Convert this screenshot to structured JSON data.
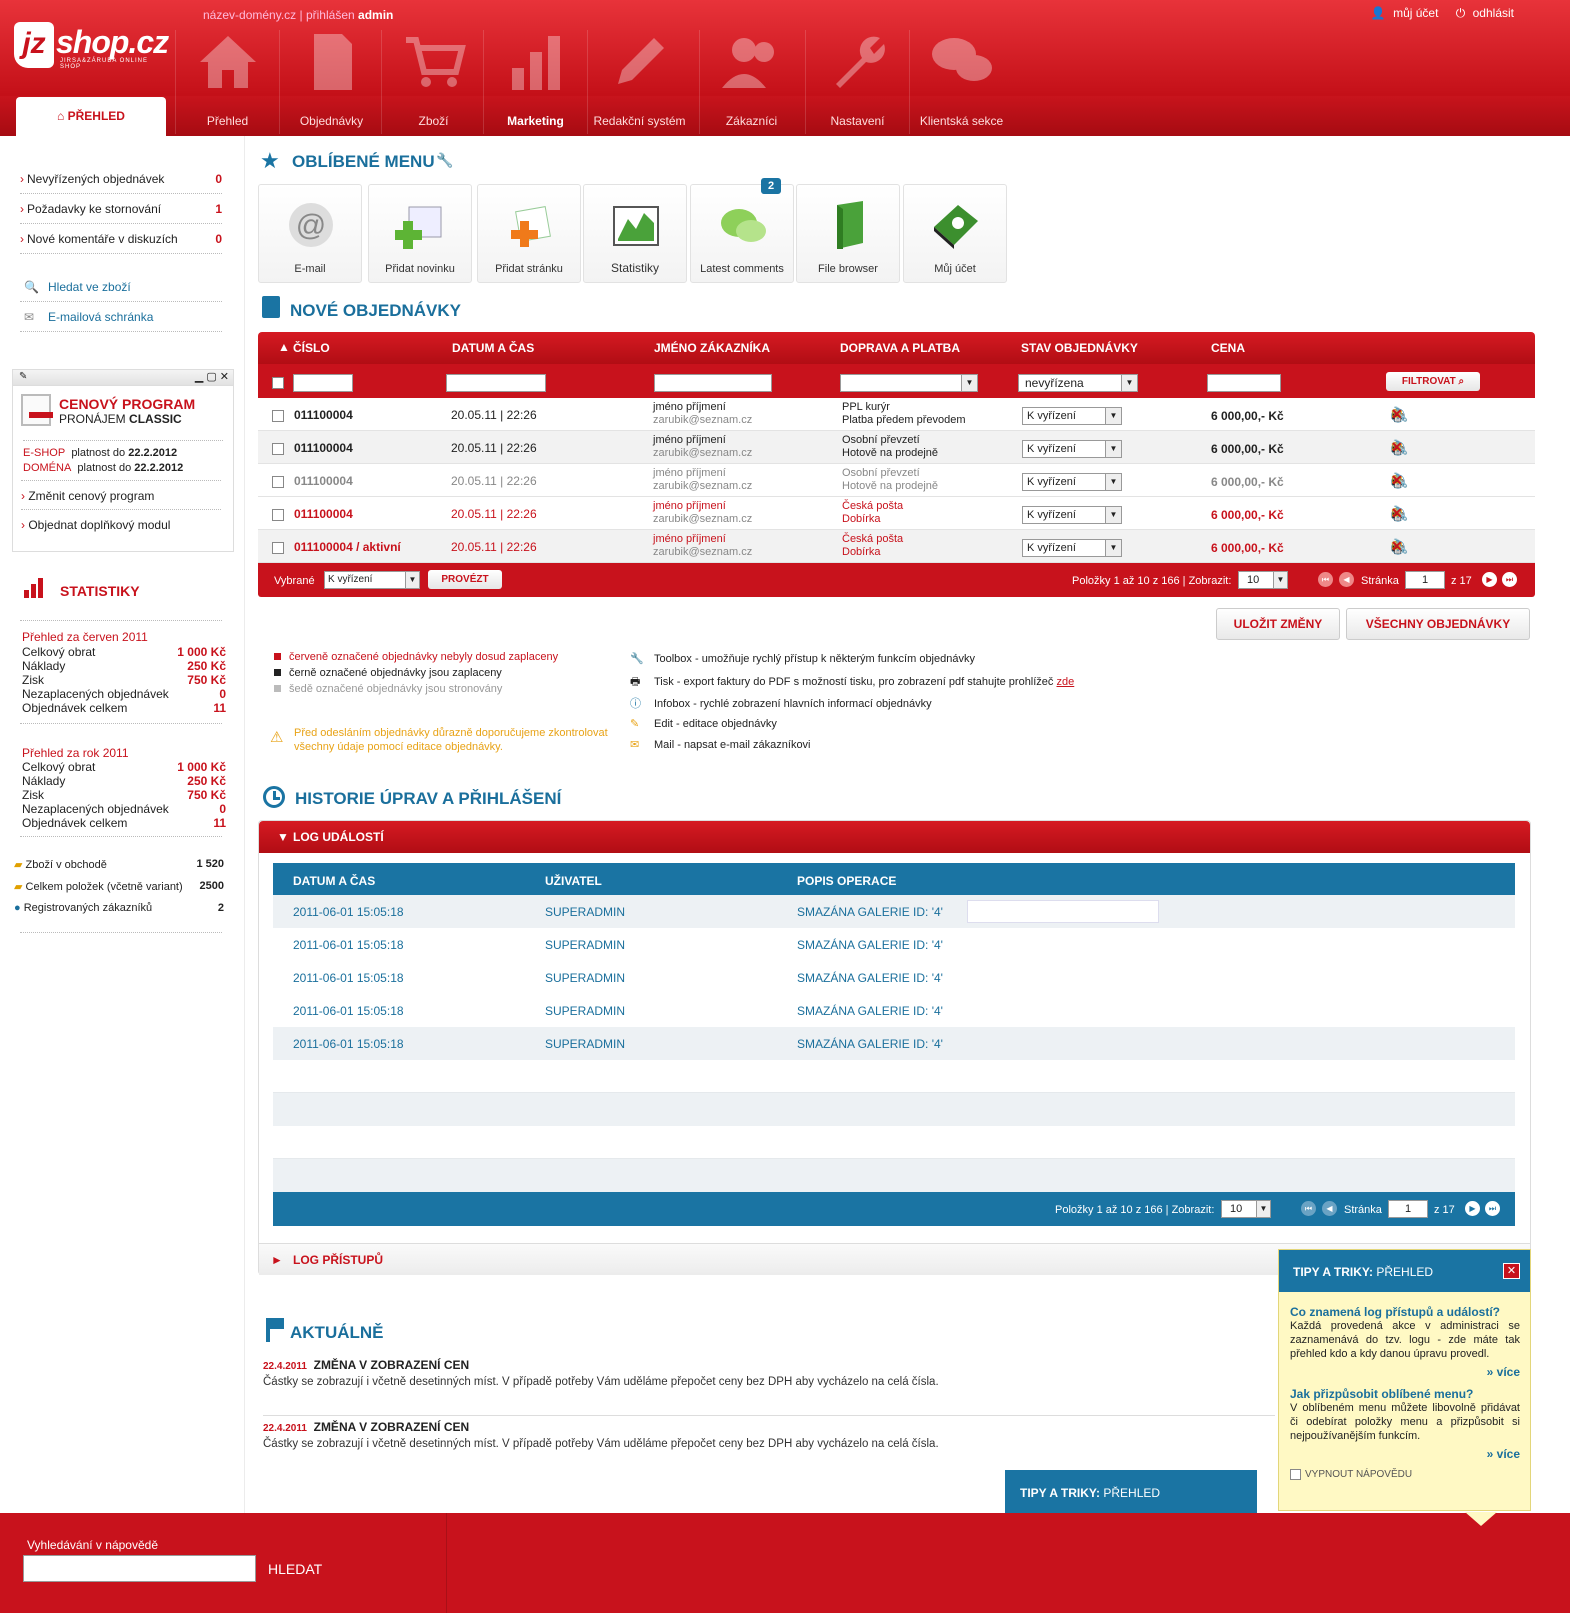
{
  "header": {
    "logo_main": "jz",
    "logo_shop": "shop.cz",
    "logo_sub": "JIRSA&ZÁRUBA ONLINE SHOP",
    "domain": "název-domény.cz",
    "separator": "|",
    "logged_in_label": "přihlášen",
    "user": "admin",
    "my_account": "můj účet",
    "logout": "odhlásit",
    "active_tab": "PŘEHLED",
    "nav": [
      "Přehled",
      "Objednávky",
      "Zboží",
      "Marketing",
      "Redakční systém",
      "Zákazníci",
      "Nastavení",
      "Klientská sekce"
    ]
  },
  "sidebar": {
    "counters": [
      {
        "label": "Nevyřízených objednávek",
        "count": "0"
      },
      {
        "label": "Požadavky ke stornování",
        "count": "1"
      },
      {
        "label": "Nové komentáře v diskuzích",
        "count": "0"
      }
    ],
    "links": [
      "Hledat ve zboží",
      "E-mailová schránka"
    ],
    "price_program": {
      "title": "CENOVÝ PROGRAM",
      "sub_prefix": "PRONÁJEM",
      "sub_bold": "CLASSIC",
      "eshop_label": "E-SHOP",
      "eshop_text": "platnost do",
      "eshop_date": "22.2.2012",
      "domain_label": "DOMÉNA",
      "domain_text": "platnost do",
      "domain_date": "22.2.2012",
      "change": "Změnit cenový program",
      "order_module": "Objednat doplňkový modul"
    },
    "stats": {
      "title": "STATISTIKY",
      "month_title": "Přehled za červen 2011",
      "year_title": "Přehled za rok 2011",
      "month": [
        {
          "l": "Celkový obrat",
          "v": "1 000 Kč"
        },
        {
          "l": "Náklady",
          "v": "250 Kč"
        },
        {
          "l": "Zisk",
          "v": "750 Kč"
        },
        {
          "l": "Nezaplacených objednávek",
          "v": "0"
        },
        {
          "l": "Objednávek celkem",
          "v": "11"
        }
      ],
      "year": [
        {
          "l": "Celkový obrat",
          "v": "1 000 Kč"
        },
        {
          "l": "Náklady",
          "v": "250 Kč"
        },
        {
          "l": "Zisk",
          "v": "750 Kč"
        },
        {
          "l": "Nezaplacených objednávek",
          "v": "0"
        },
        {
          "l": "Objednávek celkem",
          "v": "11"
        }
      ],
      "totals": [
        {
          "l": "Zboží v obchodě",
          "v": "1 520"
        },
        {
          "l": "Celkem položek (včetně variant)",
          "v": "2500"
        },
        {
          "l": "Registrovaných zákazníků",
          "v": "2"
        }
      ]
    }
  },
  "favorites": {
    "title": "OBLÍBENÉ MENU",
    "items": [
      "E-mail",
      "Přidat novinku",
      "Přidat stránku",
      "Statistiky",
      "Latest comments",
      "File browser",
      "Můj účet"
    ],
    "comments_badge": "2"
  },
  "orders": {
    "title": "NOVÉ OBJEDNÁVKY",
    "columns": [
      "ČÍSLO",
      "DATUM A ČAS",
      "JMÉNO ZÁKAZNÍKA",
      "DOPRAVA A PLATBA",
      "STAV OBJEDNÁVKY",
      "CENA"
    ],
    "filter_state": "nevyřízena",
    "filter_button": "FILTROVAT",
    "rows": [
      {
        "num": "011100004",
        "date": "20.05.11 | 22:26",
        "name": "jméno příjmení",
        "email": "zarubik@seznam.cz",
        "ship": "PPL kurýr",
        "pay": "Platba předem převodem",
        "state": "K vyřízení",
        "price": "6 000,00,- Kč"
      },
      {
        "num": "011100004",
        "date": "20.05.11 | 22:26",
        "name": "jméno příjmení",
        "email": "zarubik@seznam.cz",
        "ship": "Osobní převzetí",
        "pay": "Hotově na prodejně",
        "state": "K vyřízení",
        "price": "6 000,00,- Kč"
      },
      {
        "num": "011100004",
        "date": "20.05.11 | 22:26",
        "name": "jméno příjmení",
        "email": "zarubik@seznam.cz",
        "ship": "Osobní převzetí",
        "pay": "Hotově na prodejně",
        "state": "K vyřízení",
        "price": "6 000,00,- Kč"
      },
      {
        "num": "011100004",
        "date": "20.05.11 | 22:26",
        "name": "jméno příjmení",
        "email": "zarubik@seznam.cz",
        "ship": "Česká pošta",
        "pay": "Dobírka",
        "state": "K vyřízení",
        "price": "6 000,00,- Kč"
      },
      {
        "num": "011100004 / aktivní",
        "date": "20.05.11 | 22:26",
        "name": "jméno příjmení",
        "email": "zarubik@seznam.cz",
        "ship": "Česká pošta",
        "pay": "Dobírka",
        "state": "K vyřízení",
        "price": "6 000,00,- Kč"
      }
    ],
    "footer": {
      "selected": "Vybrané",
      "selected_value": "K vyřízení",
      "apply": "PROVÉZT",
      "items": "Položky 1 až 10 z 166 | Zobrazit:",
      "per_page": "10",
      "page_label": "Stránka",
      "page": "1",
      "of": "z 17"
    },
    "save": "ULOŽIT ZMĚNY",
    "all": "VŠECHNY OBJEDNÁVKY",
    "legend": [
      "červeně označené objednávky nebyly dosud zaplaceny",
      "černě označené objednávky jsou zaplaceny",
      "šedě označené objednávky jsou stronovány"
    ],
    "warning": "Před odesláním objednávky důrazně doporučujeme zkontrolovat všechny údaje pomocí editace objednávky.",
    "tools": [
      "Toolbox - umožňuje rychlý přístup k některým funkcím objednávky",
      "Tisk - export faktury do PDF s možností tisku, pro zobrazení pdf stahujte prohlížeč",
      "Infobox - rychlé zobrazení hlavních informací objednávky",
      "Edit - editace objednávky",
      "Mail - napsat e-mail zákazníkovi"
    ],
    "tools_link": "zde"
  },
  "history": {
    "title": "HISTORIE ÚPRAV A PŘIHLÁŠENÍ",
    "log_title": "LOG UDÁLOSTÍ",
    "columns": [
      "DATUM A ČAS",
      "UŽIVATEL",
      "POPIS OPERACE"
    ],
    "rows": [
      {
        "d": "2011-06-01 15:05:18",
        "u": "SUPERADMIN",
        "o": "SMAZÁNA GALERIE ID: '4'"
      },
      {
        "d": "2011-06-01 15:05:18",
        "u": "SUPERADMIN",
        "o": "SMAZÁNA GALERIE ID: '4'"
      },
      {
        "d": "2011-06-01 15:05:18",
        "u": "SUPERADMIN",
        "o": "SMAZÁNA GALERIE ID: '4'"
      },
      {
        "d": "2011-06-01 15:05:18",
        "u": "SUPERADMIN",
        "o": "SMAZÁNA GALERIE ID: '4'"
      },
      {
        "d": "2011-06-01 15:05:18",
        "u": "SUPERADMIN",
        "o": "SMAZÁNA GALERIE ID: '4'"
      }
    ],
    "footer": {
      "items": "Položky 1 až 10 z 166 | Zobrazit:",
      "per_page": "10",
      "page_label": "Stránka",
      "page": "1",
      "of": "z 17"
    },
    "access_title": "LOG PŘÍSTUPŮ"
  },
  "news": {
    "title": "AKTUÁLNĚ",
    "items": [
      {
        "date": "22.4.2011",
        "title": "ZMĚNA V ZOBRAZENÍ CEN",
        "text": "Částky se zobrazují i včetně desetinných míst. V případě potřeby Vám uděláme přepočet ceny bez DPH aby vycházelo na celá čísla."
      },
      {
        "date": "22.4.2011",
        "title": "ZMĚNA V ZOBRAZENÍ CEN",
        "text": "Částky se zobrazují i včetně desetinných míst. V případě potřeby Vám uděláme přepočet ceny bez DPH aby vycházelo na celá čísla."
      }
    ]
  },
  "tips": {
    "title_bold": "TIPY A TRIKY:",
    "title": "PŘEHLED",
    "q1": "Co znamená log přístupů a událostí?",
    "a1": "Každá provedená akce v administraci se zaznamenává do tzv. logu - zde máte tak přehled kdo a kdy danou úpravu provedl.",
    "q2": "Jak přizpůsobit oblíbené menu?",
    "a2": "V oblíbeném menu můžete libovolně přidávat či odebírat položky menu a přizpůsobit si nejpoužívanějším funkcím.",
    "more": "více",
    "disable": "VYPNOUT NÁPOVĚDU"
  },
  "footer": {
    "search_label": "Vyhledávání v nápovědě",
    "search_button": "HLEDAT"
  }
}
